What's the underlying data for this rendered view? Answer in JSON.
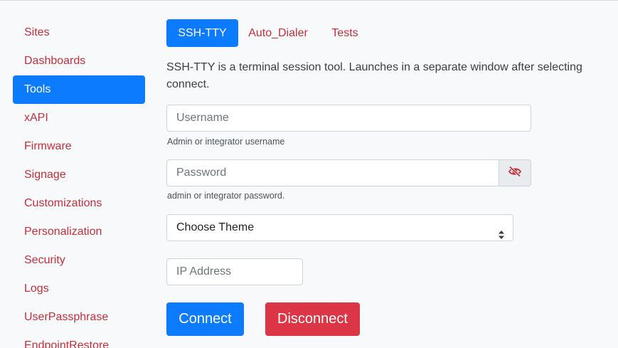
{
  "colors": {
    "primary": "#0d7bfd",
    "danger": "#dc3545",
    "link": "#c62f3a",
    "background": "#f8f9fa"
  },
  "sidebar": {
    "items": [
      {
        "label": "Sites",
        "active": false
      },
      {
        "label": "Dashboards",
        "active": false
      },
      {
        "label": "Tools",
        "active": true
      },
      {
        "label": "xAPI",
        "active": false
      },
      {
        "label": "Firmware",
        "active": false
      },
      {
        "label": "Signage",
        "active": false
      },
      {
        "label": "Customizations",
        "active": false
      },
      {
        "label": "Personalization",
        "active": false
      },
      {
        "label": "Security",
        "active": false
      },
      {
        "label": "Logs",
        "active": false
      },
      {
        "label": "UserPassphrase",
        "active": false
      },
      {
        "label": "EndpointRestore",
        "active": false
      }
    ]
  },
  "tabs": [
    {
      "label": "SSH-TTY",
      "active": true
    },
    {
      "label": "Auto_Dialer",
      "active": false
    },
    {
      "label": "Tests",
      "active": false
    }
  ],
  "main": {
    "description": "SSH-TTY is a terminal session tool. Launches in a separate window after selecting connect.",
    "username": {
      "placeholder": "Username",
      "value": "",
      "help": "Admin or integrator username"
    },
    "password": {
      "placeholder": "Password",
      "value": "",
      "help": "admin or integrator password.",
      "toggle_icon": "eye-slash-icon"
    },
    "theme": {
      "selected": "Choose Theme",
      "icon": "sort-arrows-icon"
    },
    "ip_address": {
      "placeholder": "IP Address",
      "value": ""
    },
    "connect_label": "Connect",
    "disconnect_label": "Disconnect"
  }
}
